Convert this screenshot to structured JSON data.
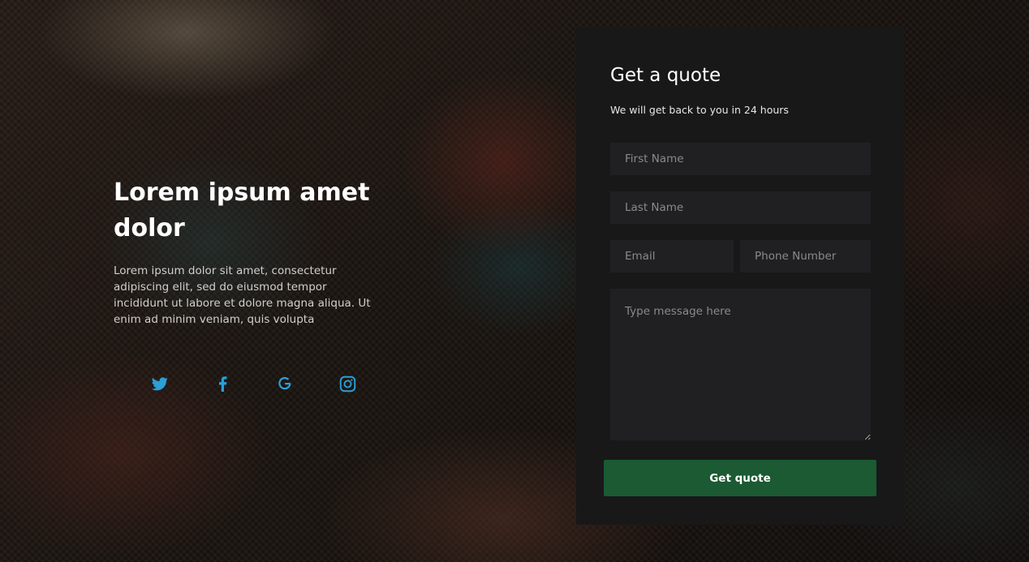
{
  "hero": {
    "headline": "Lorem ipsum amet dolor",
    "description": "Lorem ipsum dolor sit amet, consectetur adipiscing elit, sed do eiusmod tempor incididunt ut labore et dolore magna aliqua. Ut enim ad minim veniam, quis volupta"
  },
  "socials": [
    {
      "icon": "twitter-icon"
    },
    {
      "icon": "facebook-icon"
    },
    {
      "icon": "google-icon"
    },
    {
      "icon": "instagram-icon"
    }
  ],
  "form": {
    "title": "Get a quote",
    "subtitle": "We will get back to you in 24 hours",
    "first_name_placeholder": "First Name",
    "last_name_placeholder": "Last Name",
    "email_placeholder": "Email",
    "phone_placeholder": "Phone Number",
    "message_placeholder": "Type message here",
    "submit_label": "Get quote"
  },
  "colors": {
    "accent": "#1b5a33",
    "social_icon": "#2a9fd8",
    "card_bg": "#181818",
    "field_bg": "#202022"
  }
}
